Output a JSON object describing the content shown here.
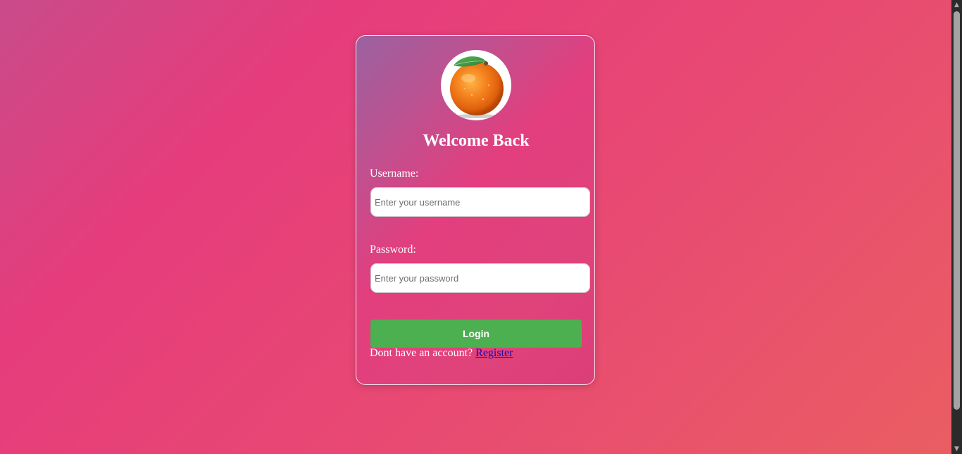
{
  "login": {
    "title": "Welcome Back",
    "username_label": "Username:",
    "username_value": "",
    "username_placeholder": "Enter your username",
    "password_label": "Password:",
    "password_value": "",
    "password_placeholder": "Enter your password",
    "login_button_label": "Login",
    "register_prompt": "Dont have an account?",
    "register_link_label": "Register",
    "logo_icon": "orange-fruit-icon"
  },
  "colors": {
    "button_green": "#4caf50",
    "link_blue": "#1a0dab",
    "background_pink": "#e63c7c"
  }
}
